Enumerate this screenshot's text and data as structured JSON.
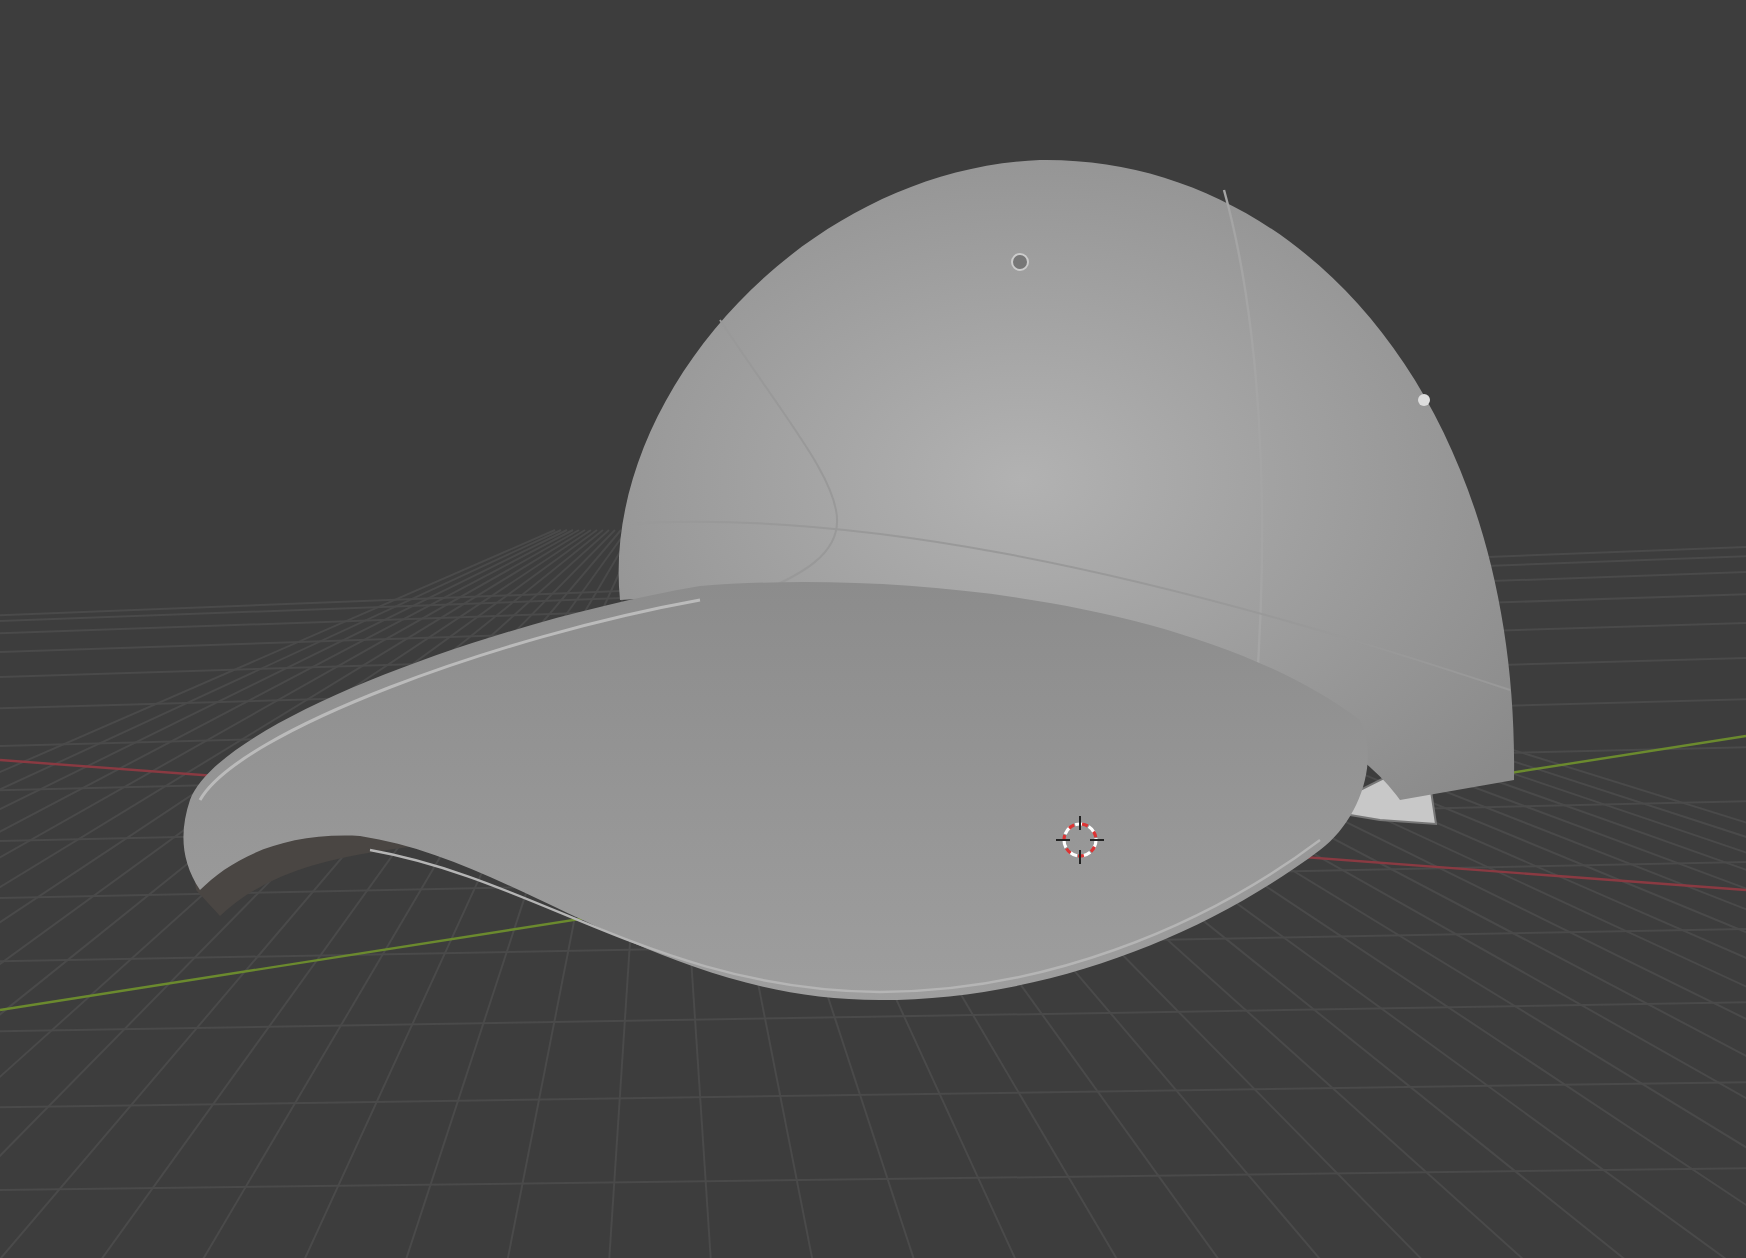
{
  "viewport": {
    "show_grid": true,
    "show_3d_cursor": true
  }
}
